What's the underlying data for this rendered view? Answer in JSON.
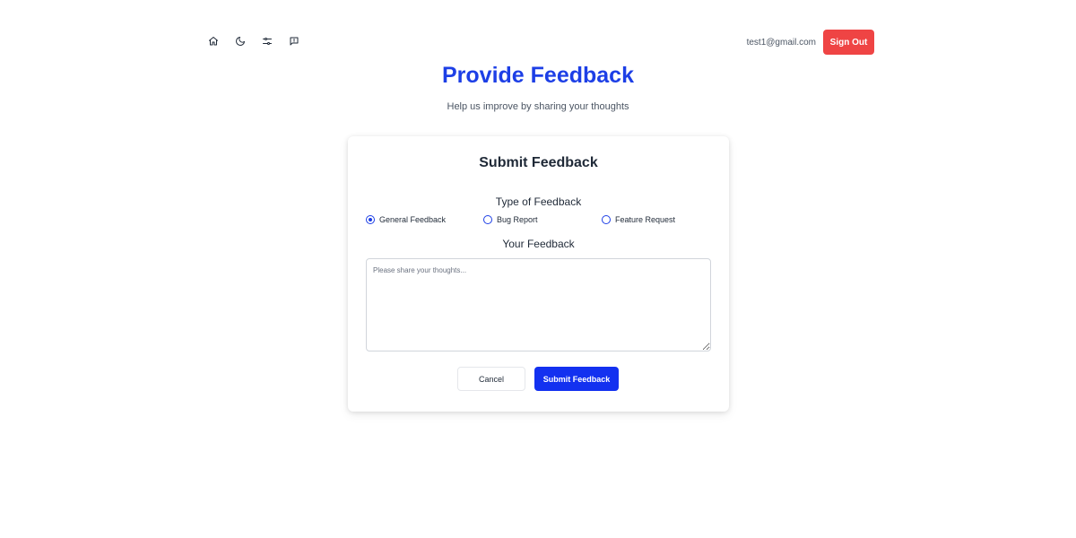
{
  "nav": {
    "icons": [
      "home-icon",
      "moon-icon",
      "settings-sliders-icon",
      "feedback-message-icon"
    ],
    "user_email": "test1@gmail.com",
    "signout_label": "Sign Out"
  },
  "header": {
    "title": "Provide Feedback",
    "subtitle": "Help us improve by sharing your thoughts"
  },
  "form": {
    "title": "Submit Feedback",
    "type_label": "Type of Feedback",
    "options": [
      {
        "label": "General Feedback",
        "checked": true
      },
      {
        "label": "Bug Report",
        "checked": false
      },
      {
        "label": "Feature Request",
        "checked": false
      }
    ],
    "feedback_label": "Your Feedback",
    "feedback_placeholder": "Please share your thoughts...",
    "feedback_value": "",
    "cancel_label": "Cancel",
    "submit_label": "Submit Feedback"
  },
  "colors": {
    "accent": "#1d3fe6",
    "submit": "#1331f0",
    "signout": "#ef4444"
  }
}
